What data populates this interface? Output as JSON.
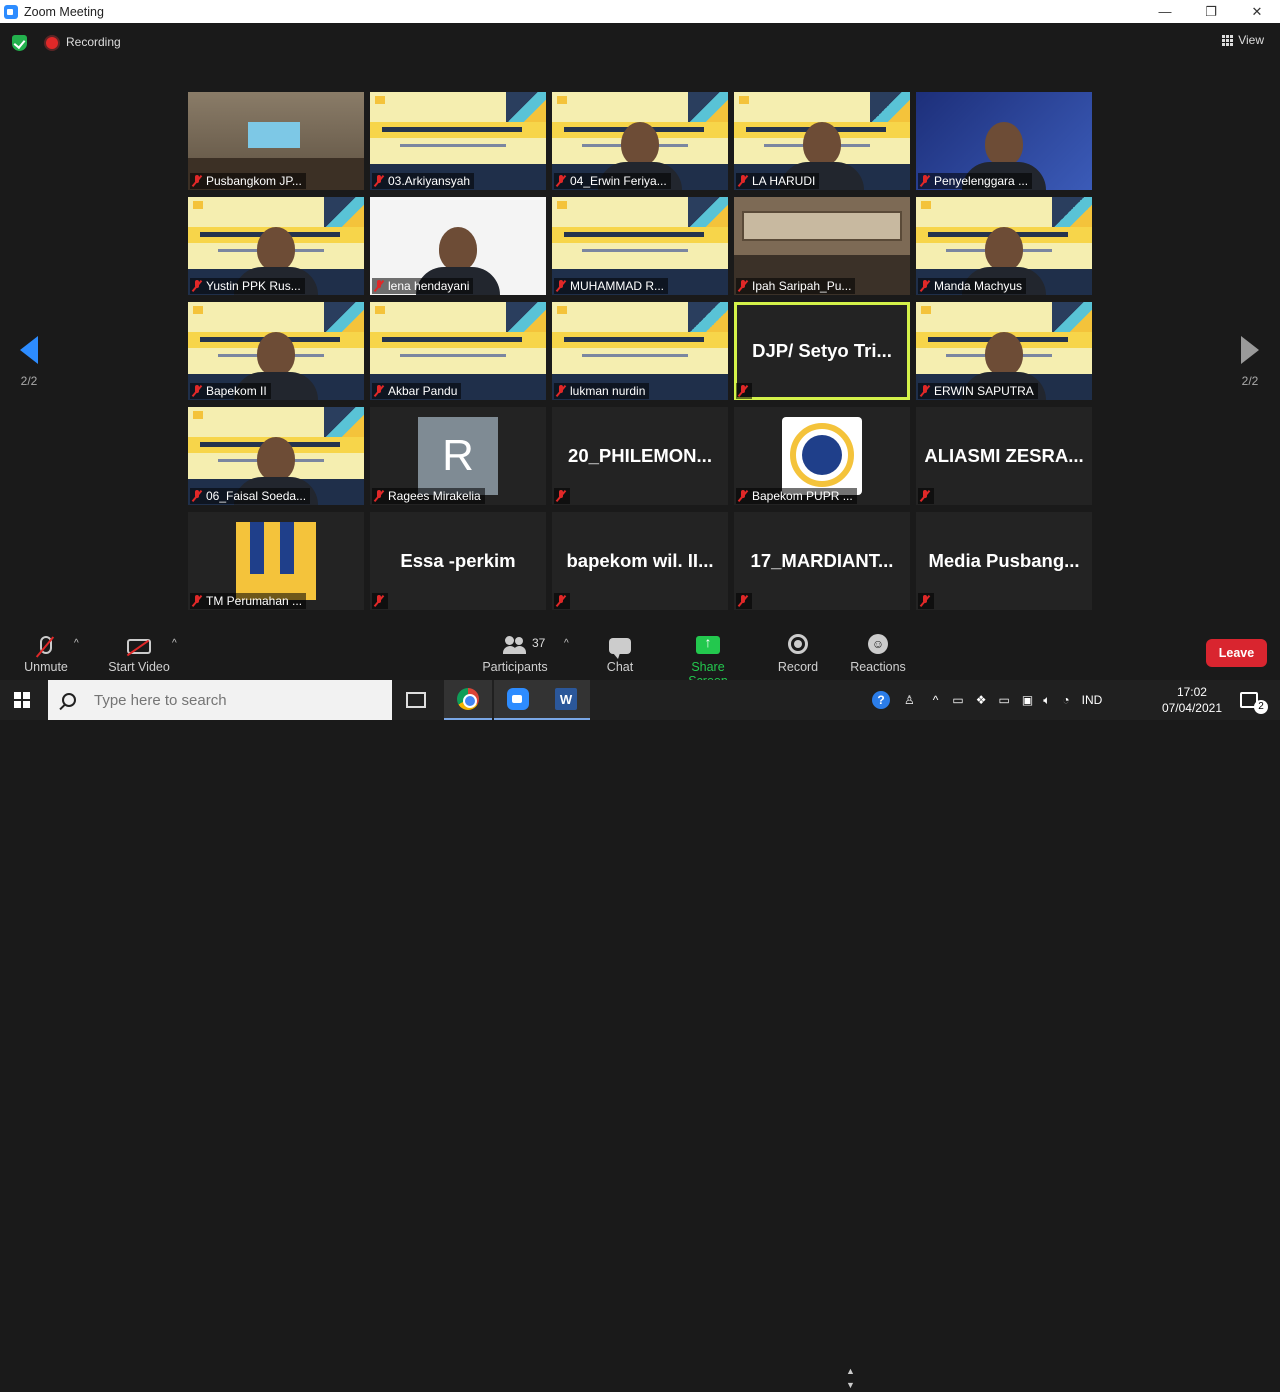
{
  "window": {
    "title": "Zoom Meeting",
    "minimize": "—",
    "restore": "❐",
    "close": "✕"
  },
  "topbar": {
    "recording_label": "Recording",
    "view_label": "View"
  },
  "paging": {
    "left_page": "2/2",
    "right_page": "2/2"
  },
  "tiles": [
    {
      "name": "Pusbangkom JP...",
      "kind": "room"
    },
    {
      "name": "03.Arkiyansyah",
      "kind": "banner"
    },
    {
      "name": "04_Erwin Feriya...",
      "kind": "banner-person"
    },
    {
      "name": "LA HARUDI",
      "kind": "banner-person"
    },
    {
      "name": "Penyelenggara ...",
      "kind": "blue-person"
    },
    {
      "name": "Yustin PPK Rus...",
      "kind": "banner-person"
    },
    {
      "name": "lena hendayani",
      "kind": "white-person"
    },
    {
      "name": "MUHAMMAD R...",
      "kind": "banner"
    },
    {
      "name": "Ipah Saripah_Pu...",
      "kind": "cabinet"
    },
    {
      "name": "Manda Machyus",
      "kind": "banner-person"
    },
    {
      "name": "Bapekom II",
      "kind": "banner-person"
    },
    {
      "name": "Akbar Pandu",
      "kind": "banner"
    },
    {
      "name": "lukman nurdin",
      "kind": "banner"
    },
    {
      "name": "DJP/ Setyo Tri...",
      "kind": "text-active"
    },
    {
      "name": "ERWIN SAPUTRA",
      "kind": "banner-person"
    },
    {
      "name": "06_Faisal Soeda...",
      "kind": "banner-person"
    },
    {
      "name": "Ragees Mirakelia",
      "kind": "avatar-r"
    },
    {
      "name": "20_PHILEMON...",
      "kind": "text"
    },
    {
      "name": "Bapekom PUPR ...",
      "kind": "pu-logo"
    },
    {
      "name": "ALIASMI ZESRA...",
      "kind": "text"
    },
    {
      "name": "TM Perumahan ...",
      "kind": "pu-big"
    },
    {
      "name": "Essa -perkim",
      "kind": "text"
    },
    {
      "name": "bapekom wil. II...",
      "kind": "text"
    },
    {
      "name": "17_MARDIANT...",
      "kind": "text"
    },
    {
      "name": "Media Pusbang...",
      "kind": "text"
    }
  ],
  "avatar_letter": "R",
  "toolbar": {
    "unmute": "Unmute",
    "start_video": "Start Video",
    "participants": "Participants",
    "participants_count": "37",
    "chat": "Chat",
    "share_screen": "Share Screen",
    "record": "Record",
    "reactions": "Reactions",
    "leave": "Leave"
  },
  "taskbar": {
    "search_placeholder": "Type here to search",
    "language": "IND",
    "time": "17:02",
    "date": "07/04/2021",
    "notifications": "2"
  },
  "colors": {
    "zoom_blue": "#2d8cff",
    "share_green": "#23c84e",
    "leave_red": "#d9252f",
    "active_border": "#d4f24a"
  }
}
